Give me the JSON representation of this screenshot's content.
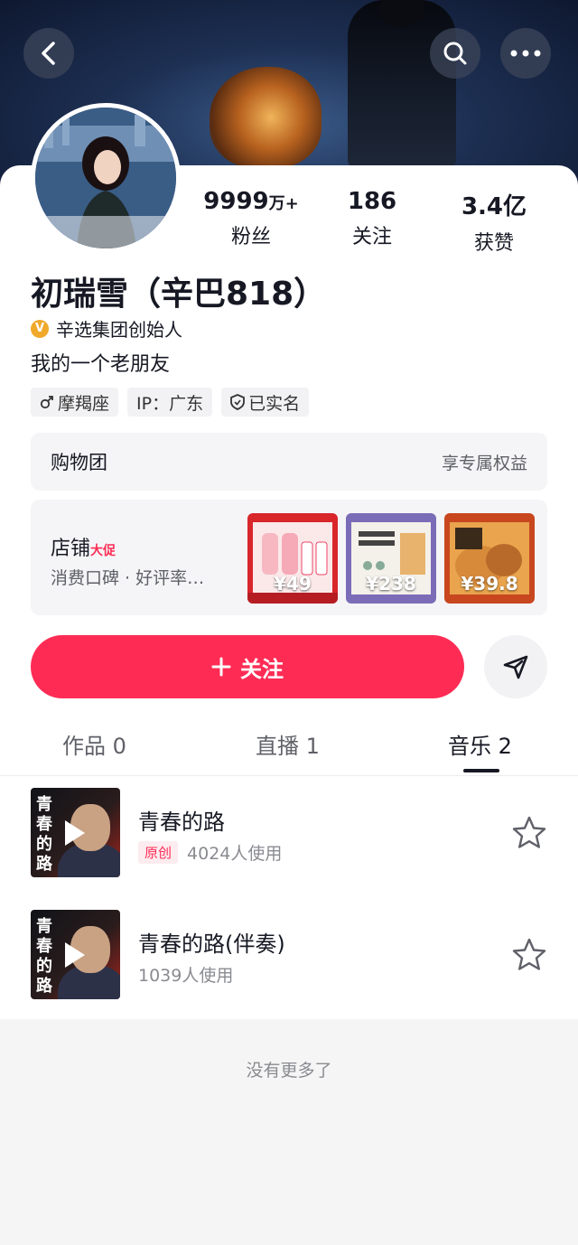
{
  "profile": {
    "name": "初瑞雪（辛巴818）",
    "verified_title": "辛选集团创始人",
    "bio": "我的一个老朋友",
    "stats": [
      {
        "value": "9999",
        "unit": "万+",
        "label": "粉丝"
      },
      {
        "value": "186",
        "unit": "",
        "label": "关注"
      },
      {
        "value": "3.4亿",
        "unit": "",
        "label": "获赞"
      }
    ],
    "tags": {
      "zodiac": "摩羯座",
      "ip": "IP：广东",
      "realname": "已实名"
    }
  },
  "shopping_group": {
    "title": "购物团",
    "right": "享专属权益"
  },
  "shop": {
    "title": "店铺",
    "promo": "大促",
    "sub": "消费口碑 · 好评率…",
    "products": [
      {
        "price": "¥49",
        "color": "#d8262b"
      },
      {
        "price": "¥238",
        "color": "#7b6cb8"
      },
      {
        "price": "¥39.8",
        "color": "#c8471f"
      }
    ]
  },
  "actions": {
    "follow": "关注"
  },
  "tabs": [
    {
      "label": "作品 0",
      "active": false
    },
    {
      "label": "直播 1",
      "active": false
    },
    {
      "label": "音乐 2",
      "active": true
    }
  ],
  "songs": [
    {
      "title": "青春的路",
      "badge": "原创",
      "usage": "4024人使用",
      "cover_text": "青春的路"
    },
    {
      "title": "青春的路(伴奏)",
      "badge": "",
      "usage": "1039人使用",
      "cover_text": "青春的路"
    }
  ],
  "footer": {
    "no_more": "没有更多了"
  },
  "colors": {
    "accent": "#fe2c55",
    "verify": "#f0a92b"
  }
}
